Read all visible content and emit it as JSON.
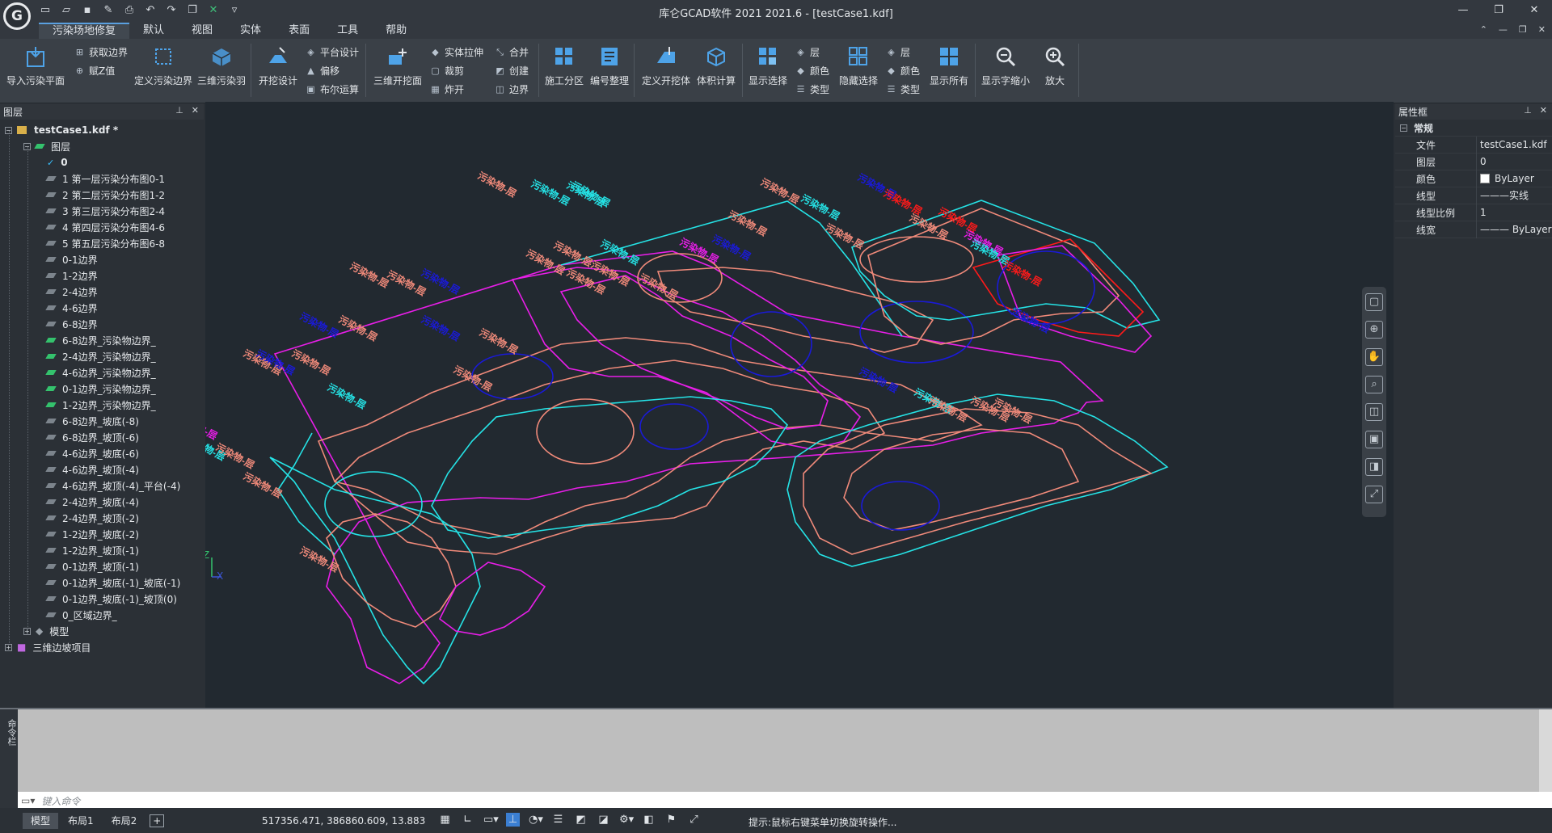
{
  "window": {
    "title": "库仑GCAD软件 2021 2021.6 - [testCase1.kdf]",
    "logo_letter": "G"
  },
  "menu": [
    "污染场地修复",
    "默认",
    "视图",
    "实体",
    "表面",
    "工具",
    "帮助"
  ],
  "ribbon": {
    "import_plane": "导入污染平面",
    "get_boundary": "获取边界",
    "assign_z": "赋Z值",
    "define_boundary": "定义污染边界",
    "pollution_3d": "三维污染羽",
    "excavation_design": "开挖设计",
    "platform_design": "平台设计",
    "offset": "偏移",
    "boolean": "布尔运算",
    "excavation_3d": "三维开挖面",
    "solid_extrude": "实体拉伸",
    "clip": "裁剪",
    "explode": "炸开",
    "merge": "合并",
    "create": "创建",
    "edge": "边界",
    "construction_zone": "施工分区",
    "numbering": "编号整理",
    "define_excavation": "定义开挖体",
    "volume_calc": "体积计算",
    "show_select": "显示选择",
    "layer": "层",
    "color": "颜色",
    "type": "类型",
    "hide_select": "隐藏选择",
    "layer2": "层",
    "color2": "颜色",
    "type2": "类型",
    "show_all": "显示所有",
    "text_shrink": "显示字缩小",
    "zoom_in": "放大"
  },
  "layer_panel": {
    "title": "图层",
    "file": "testCase1.kdf *",
    "group": "图层",
    "layers": [
      "0",
      "1 第一层污染分布图0-1",
      "2 第二层污染分布图1-2",
      "3 第三层污染分布图2-4",
      "4 第四层污染分布图4-6",
      "5 第五层污染分布图6-8",
      "0-1边界",
      "1-2边界",
      "2-4边界",
      "4-6边界",
      "6-8边界",
      "6-8边界_污染物边界_",
      "2-4边界_污染物边界_",
      "4-6边界_污染物边界_",
      "0-1边界_污染物边界_",
      "1-2边界_污染物边界_",
      "6-8边界_坡底(-8)",
      "6-8边界_坡顶(-6)",
      "4-6边界_坡底(-6)",
      "4-6边界_坡顶(-4)",
      "4-6边界_坡顶(-4)_平台(-4)",
      "2-4边界_坡底(-4)",
      "2-4边界_坡顶(-2)",
      "1-2边界_坡底(-2)",
      "1-2边界_坡顶(-1)",
      "0-1边界_坡顶(-1)",
      "0-1边界_坡底(-1)_坡底(-1)",
      "0-1边界_坡底(-1)_坡顶(0)",
      "0_区域边界_"
    ],
    "model": "模型",
    "project": "三维边坡项目"
  },
  "prop_panel": {
    "title": "属性框",
    "section": "常规",
    "rows": [
      {
        "key": "文件",
        "val": "testCase1.kdf"
      },
      {
        "key": "图层",
        "val": "0"
      },
      {
        "key": "颜色",
        "val": "ByLayer"
      },
      {
        "key": "线型",
        "val": "———实线"
      },
      {
        "key": "线型比例",
        "val": "1"
      },
      {
        "key": "线宽",
        "val": "——— ByLayer"
      }
    ]
  },
  "canvas": {
    "label_text": "污染物-层",
    "axis_z": "Z",
    "axis_x": "X"
  },
  "command": {
    "side_label": "命令栏",
    "placeholder": "键入命令"
  },
  "status": {
    "tabs": [
      "模型",
      "布局1",
      "布局2"
    ],
    "add_tab": "+",
    "coords": "517356.471, 386860.609, 13.883",
    "hint": "提示:鼠标右键菜单切换旋转操作..."
  },
  "colors": {
    "cyan": "#25e3e6",
    "magenta": "#e81ee8",
    "salmon": "#f08a7a",
    "blue": "#1a1ad8",
    "red": "#ff1a1a",
    "canvas_bg": "#222930"
  }
}
